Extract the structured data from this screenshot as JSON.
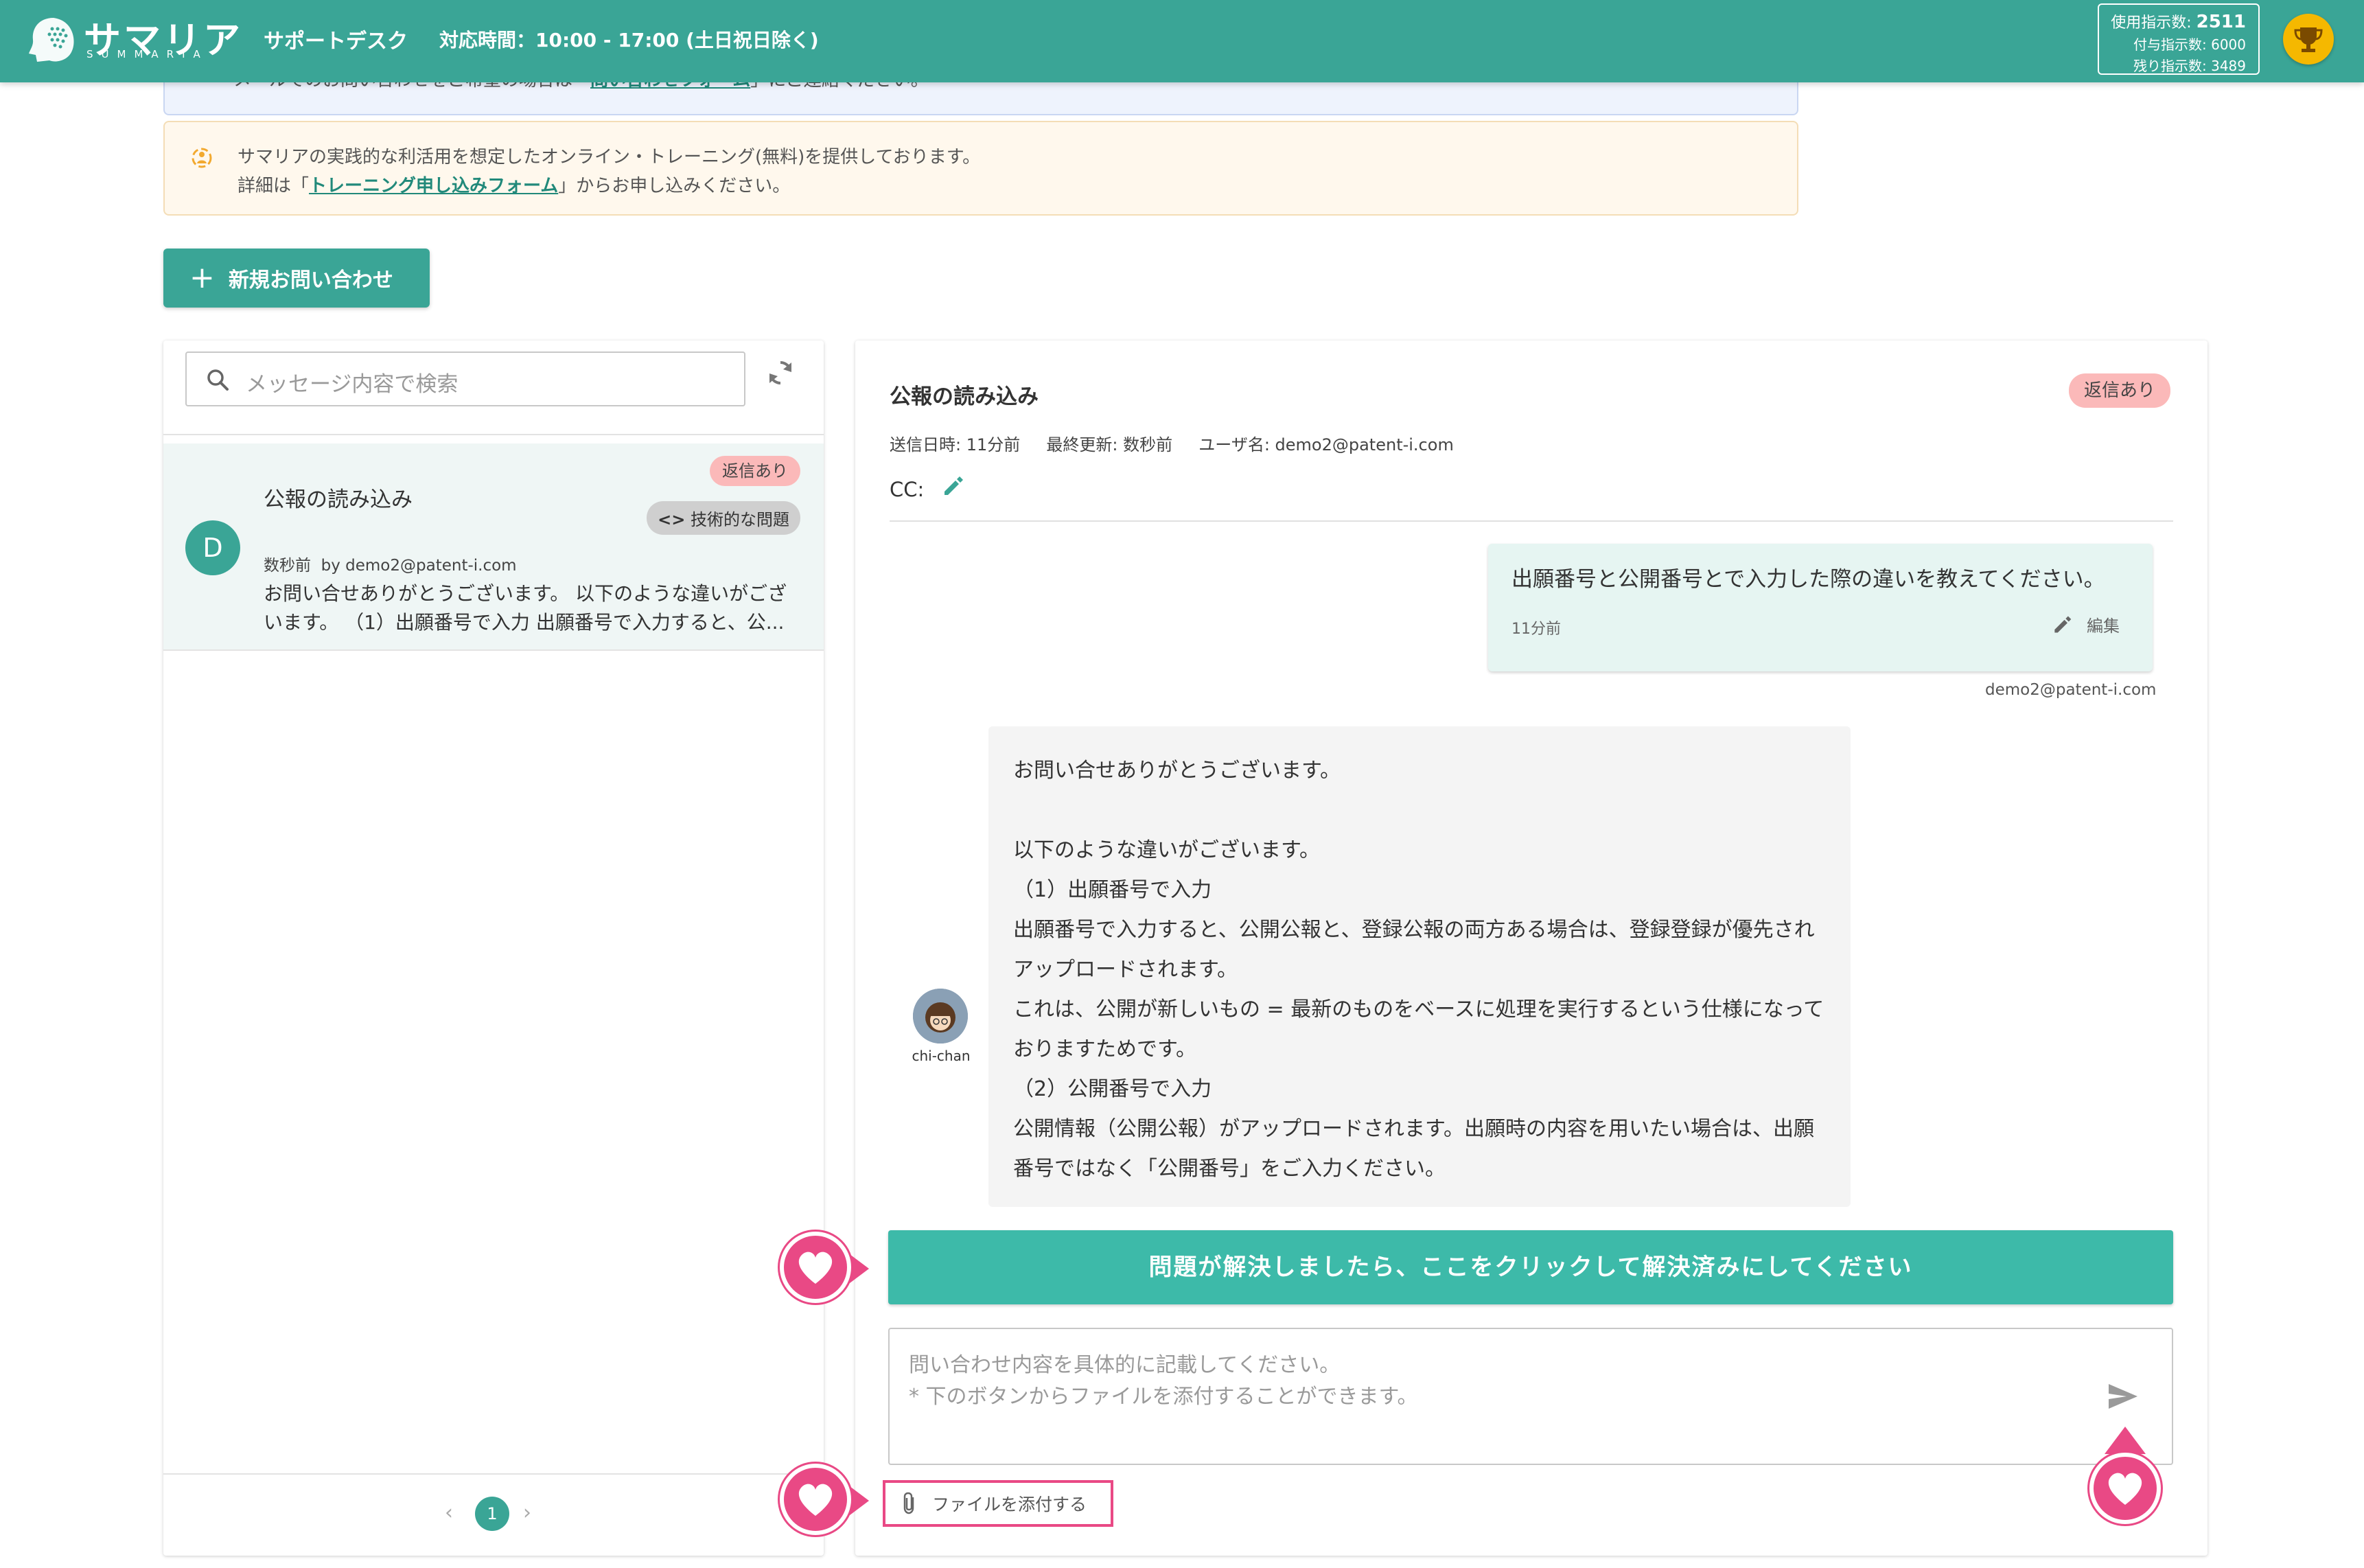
{
  "header": {
    "logo_text": "サマリア",
    "logo_sub": "SUMMARIA",
    "title": "サポートデスク",
    "hours": "対応時間：10:00 - 17:00 (土日祝日除く)",
    "usage_label": "使用指示数:",
    "usage_value": "2511",
    "granted": "付与指示数: 6000",
    "remaining": "残り指示数: 3489"
  },
  "notices": {
    "blue_text_pre": "メールでのお問い合わせをご希望の場合は「",
    "blue_link": "問い合わせフォーム",
    "blue_text_post": "」にご連絡ください。",
    "orange_line1": "サマリアの実践的な利活用を想定したオンライン・トレーニング(無料)を提供しております。",
    "orange_line2_pre": "詳細は「",
    "orange_link": "トレーニング申し込みフォーム",
    "orange_line2_post": "」からお申し込みください。"
  },
  "new_inquiry_label": "新規お問い合わせ",
  "list": {
    "search_placeholder": "メッセージ内容で検索",
    "items": [
      {
        "avatar": "D",
        "title": "公報の読み込み",
        "badge": "返信あり",
        "category": "技術的な問題",
        "time": "数秒前",
        "by": "by demo2@patent-i.com",
        "preview": "お問い合せありがとうございます。 以下のような違いがございます。 （1）出願番号で入力 出願番号で入力すると、公..."
      }
    ],
    "pagination": {
      "prev": "‹",
      "page": "1",
      "next": "›"
    }
  },
  "detail": {
    "title": "公報の読み込み",
    "badge": "返信あり",
    "sent": "送信日時: 11分前",
    "updated": "最終更新: 数秒前",
    "user": "ユーザ名: demo2@patent-i.com",
    "cc_label": "CC:",
    "user_message": {
      "text": "出願番号と公開番号とで入力した際の違いを教えてください。",
      "time": "11分前",
      "edit_label": "編集",
      "email": "demo2@patent-i.com"
    },
    "staff_message": {
      "name": "chi-chan",
      "text": "お問い合せありがとうございます。\n\n以下のような違いがございます。\n（1）出願番号で入力\n出願番号で入力すると、公開公報と、登録公報の両方ある場合は、登録登録が優先されアップロードされます。\nこれは、公開が新しいもの = 最新のものをベースに処理を実行するという仕様になっておりますためです。\n（2）公開番号で入力\n公開情報（公開公報）がアップロードされます。出願時の内容を用いたい場合は、出願番号ではなく「公開番号」をご入力ください。"
    },
    "resolve_label": "問題が解決しましたら、ここをクリックして解決済みにしてください",
    "reply_placeholder": "問い合わせ内容を具体的に記載してください。\n* 下のボタンからファイルを添付することができます。",
    "attach_label": "ファイルを添付する"
  },
  "colors": {
    "brand": "#3aa596",
    "resolve": "#3dbaa9",
    "badge_reply": "#fbb9b9",
    "highlight": "#e94985"
  }
}
